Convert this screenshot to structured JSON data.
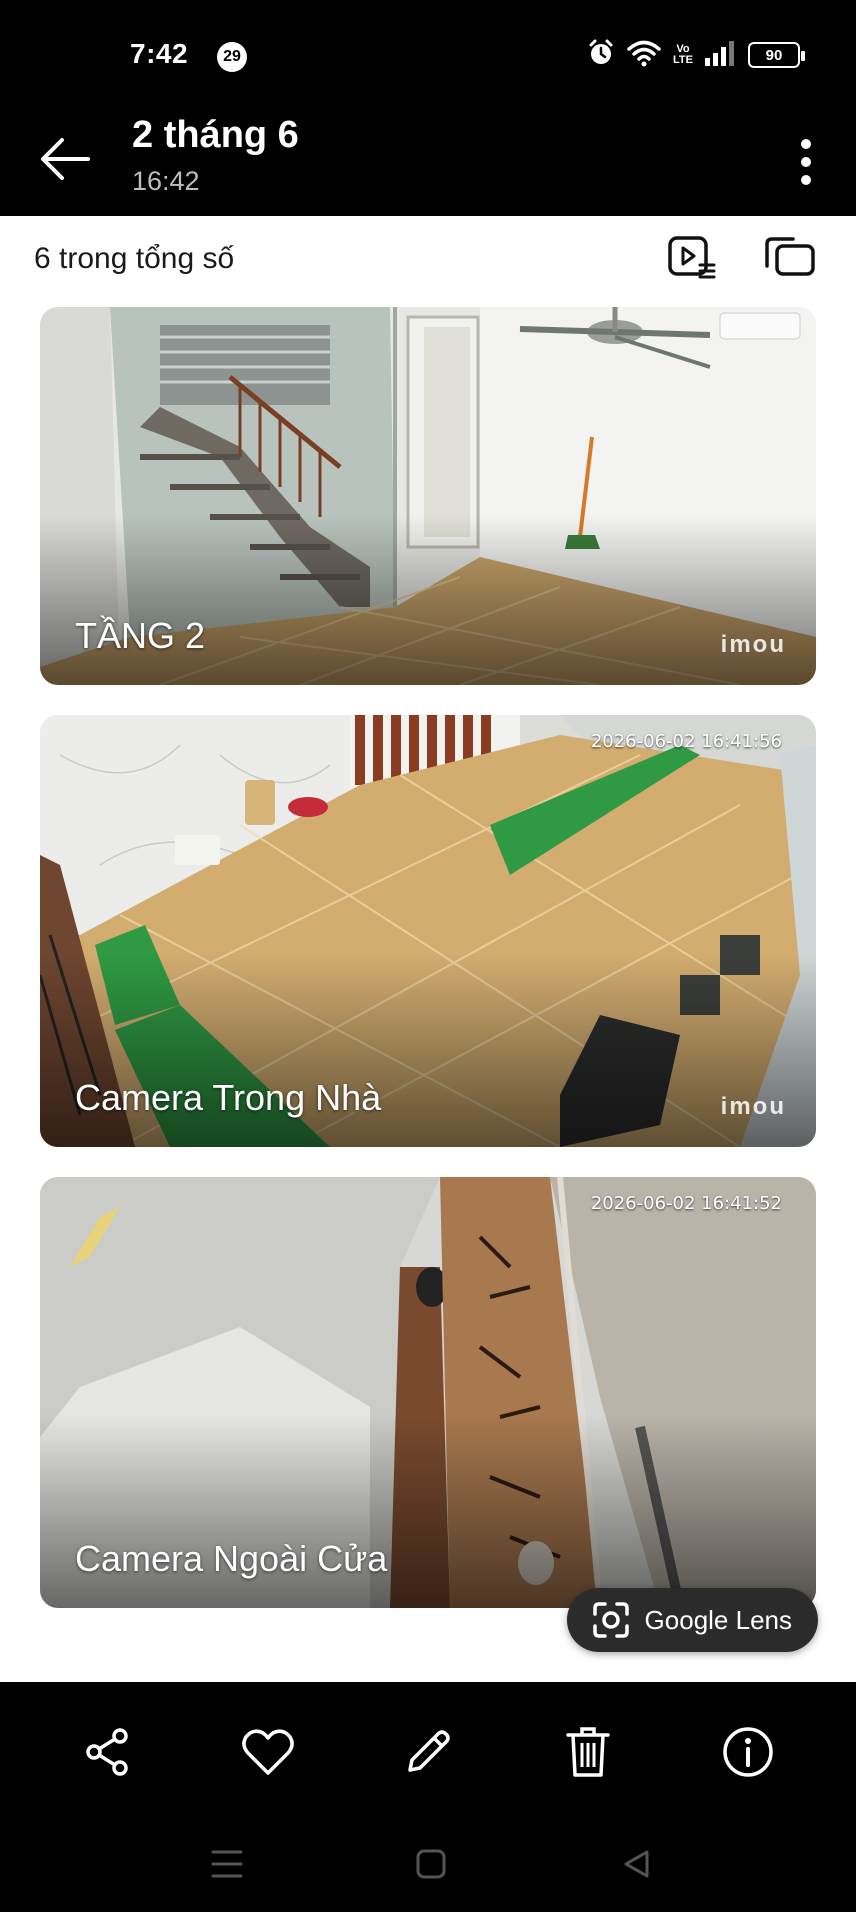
{
  "status_bar": {
    "time": "7:42",
    "notification_count": "29",
    "network_badge": "Vo\nLTE",
    "battery": "90"
  },
  "header": {
    "title": "2 tháng 6",
    "subtitle": "16:42"
  },
  "toolbar": {
    "count_text": "6 trong tổng số"
  },
  "cameras": [
    {
      "title": "TẦNG 2",
      "timestamp": "",
      "watermark": "imou"
    },
    {
      "title": "Camera Trong Nhà",
      "timestamp": "2026-06-02 16:41:56",
      "watermark": "imou"
    },
    {
      "title": "Camera Ngoài Cửa",
      "timestamp": "2026-06-02 16:41:52",
      "watermark": ""
    }
  ],
  "lens": {
    "label": "Google Lens"
  },
  "actions": [
    "share-icon",
    "heart-icon",
    "edit-icon",
    "trash-icon",
    "info-icon"
  ],
  "nav": [
    "recents-icon",
    "home-icon",
    "back-icon"
  ],
  "colors": {
    "content_bg": "#ffffff",
    "bars_bg": "#000000",
    "lens_bg": "#2b2b2b",
    "floor_wood": "#c9a36a",
    "turf_green": "#2f9a43"
  }
}
